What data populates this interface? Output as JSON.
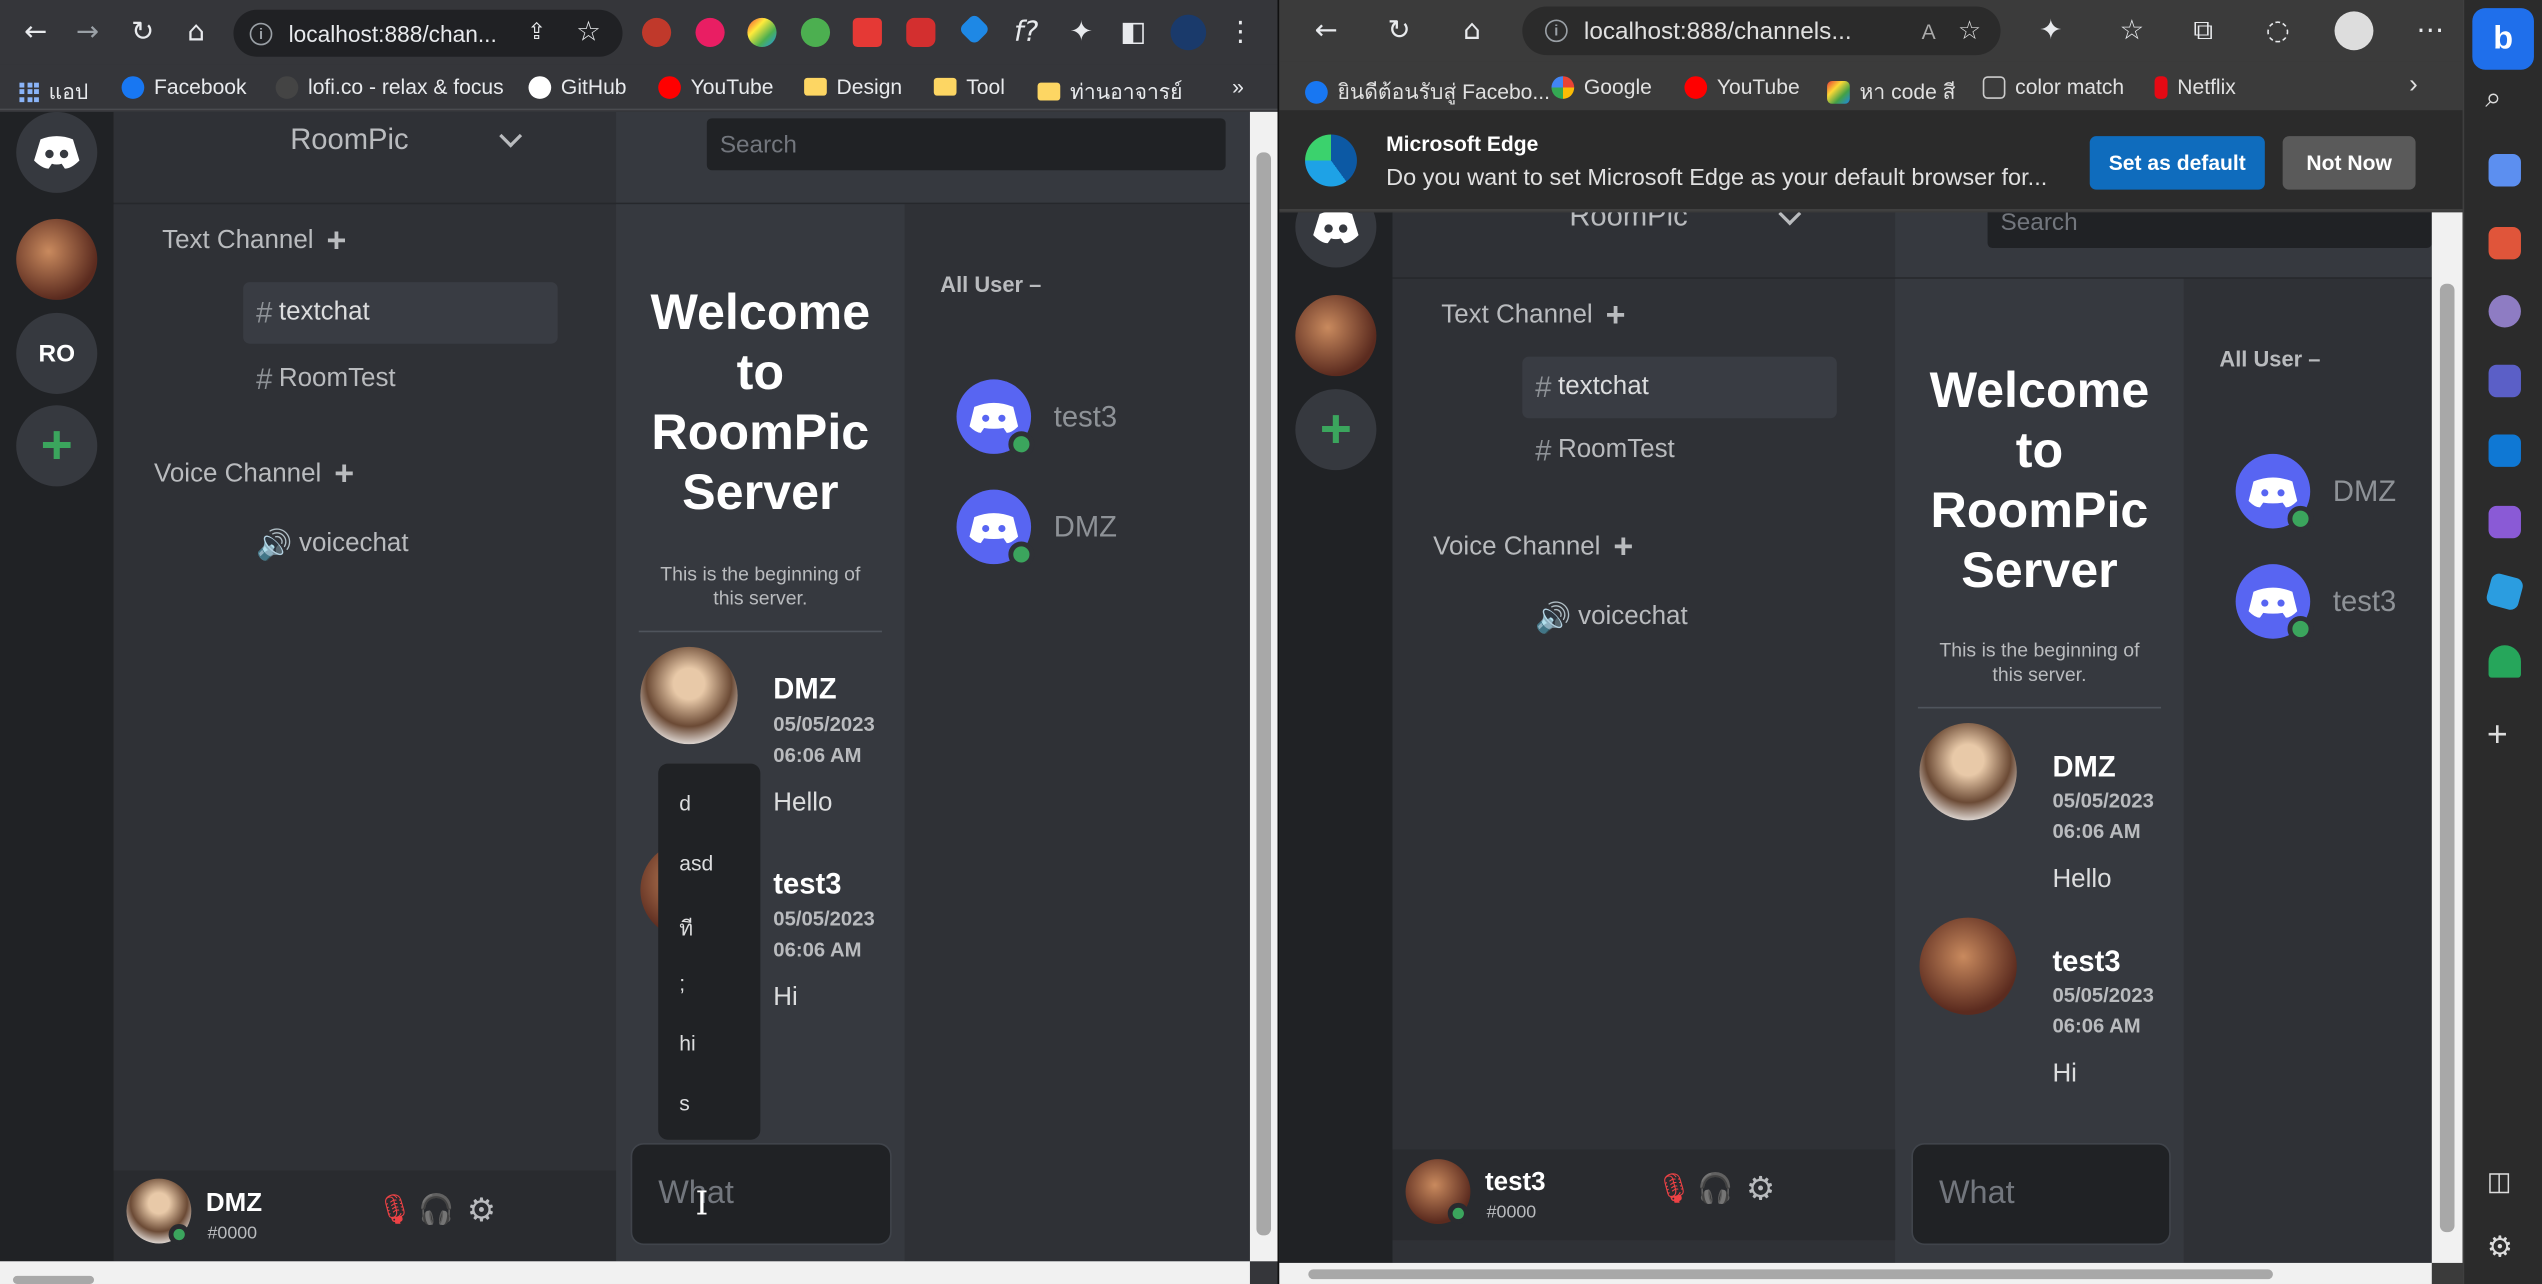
{
  "chrome": {
    "url": "localhost:888/chan...",
    "bookmarks": [
      "แอป",
      "Facebook",
      "lofi.co - relax & focus",
      "GitHub",
      "YouTube",
      "Design",
      "Tool",
      "ท่านอาจารย์"
    ],
    "more": "»"
  },
  "edge": {
    "url": "localhost:888/channels...",
    "bookmarks": [
      "ยินดีต้อนรับสู่ Facebo...",
      "Google",
      "YouTube",
      "หา code สี",
      "color match",
      "Netflix"
    ],
    "infobar": {
      "title": "Microsoft Edge",
      "message": "Do you want to set Microsoft Edge as your default browser for...",
      "primary": "Set as default",
      "secondary": "Not Now"
    }
  },
  "left_app": {
    "server_name": "RoomPic",
    "server_initials": "RO",
    "search_placeholder": "Search",
    "text_category": "Text Channel",
    "voice_category": "Voice Channel",
    "text_channels": [
      "textchat",
      "RoomTest"
    ],
    "voice_channels": [
      "voicechat"
    ],
    "welcome_title": "Welcome to RoomPic Server",
    "welcome_sub": "This is the beginning of this server.",
    "messages": [
      {
        "author": "DMZ",
        "date": "05/05/2023",
        "time": "06:06 AM",
        "text": "Hello"
      },
      {
        "author": "test3",
        "date": "05/05/2023",
        "time": "06:06 AM",
        "text": "Hi"
      }
    ],
    "members_title": "All User –",
    "members": [
      "test3",
      "DMZ"
    ],
    "user": {
      "name": "DMZ",
      "tag": "#0000"
    },
    "input_placeholder": "What",
    "autocomplete": [
      "d",
      "asd",
      "ที",
      ";",
      "hi",
      "s"
    ]
  },
  "right_app": {
    "server_name": "RoomPic",
    "search_placeholder": "Search",
    "text_category": "Text Channel",
    "voice_category": "Voice Channel",
    "text_channels": [
      "textchat",
      "RoomTest"
    ],
    "voice_channels": [
      "voicechat"
    ],
    "welcome_title": "Welcome to RoomPic Server",
    "welcome_sub": "This is the beginning of this server.",
    "messages": [
      {
        "author": "DMZ",
        "date": "05/05/2023",
        "time": "06:06 AM",
        "text": "Hello"
      },
      {
        "author": "test3",
        "date": "05/05/2023",
        "time": "06:06 AM",
        "text": "Hi"
      }
    ],
    "members_title": "All User –",
    "members": [
      "DMZ",
      "test3"
    ],
    "user": {
      "name": "test3",
      "tag": "#0000"
    },
    "input_placeholder": "What"
  },
  "icons": {
    "online_color": "#3ba55d",
    "accent": "#5865f2",
    "add_server_color": "#3ba55d"
  }
}
